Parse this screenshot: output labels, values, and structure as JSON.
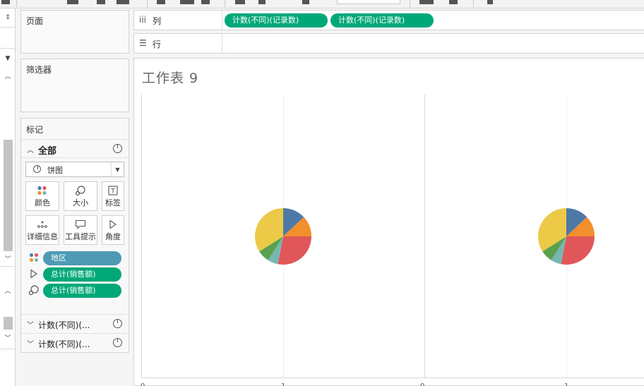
{
  "shelves": {
    "pages_label": "页面",
    "filters_label": "筛选器",
    "marks_label": "标记",
    "marks_all_label": "全部",
    "mark_type": "饼图",
    "mark_buttons": [
      {
        "label": "颜色",
        "icon": "color-dots-icon"
      },
      {
        "label": "大小",
        "icon": "size-icon"
      },
      {
        "label": "标签",
        "icon": "label-icon"
      },
      {
        "label": "详细信息",
        "icon": "detail-icon"
      },
      {
        "label": "工具提示",
        "icon": "tooltip-icon"
      },
      {
        "label": "角度",
        "icon": "angle-icon"
      }
    ],
    "mark_fields": [
      {
        "label": "地区",
        "icon": "color-dots-icon",
        "color": "#4e9ab4"
      },
      {
        "label": "总计(销售额)",
        "icon": "angle-icon",
        "color": "#00a878"
      },
      {
        "label": "总计(销售额)",
        "icon": "size-icon",
        "color": "#00a878"
      }
    ],
    "sub_cards": [
      "计数(不同)(...",
      "计数(不同)(..."
    ]
  },
  "columns": {
    "label": "列",
    "pills": [
      "计数(不同)(记录数)",
      "计数(不同)(记录数)"
    ]
  },
  "rows": {
    "label": "行"
  },
  "sheet": {
    "title": "工作表 9",
    "tick_labels": [
      "0",
      "1",
      "0",
      "1"
    ]
  },
  "colors": {
    "accent_green": "#00a878",
    "dimension_blue": "#4e9ab4"
  },
  "pies": [
    {
      "slices": [
        {
          "value": 13,
          "color": "#4e79a7"
        },
        {
          "value": 12,
          "color": "#f28e2b"
        },
        {
          "value": 28,
          "color": "#e15759"
        },
        {
          "value": 6,
          "color": "#76b7b2"
        },
        {
          "value": 7,
          "color": "#59a14f"
        },
        {
          "value": 34,
          "color": "#edc948"
        }
      ]
    },
    {
      "slices": [
        {
          "value": 13,
          "color": "#4e79a7"
        },
        {
          "value": 12,
          "color": "#f28e2b"
        },
        {
          "value": 28,
          "color": "#e15759"
        },
        {
          "value": 6,
          "color": "#76b7b2"
        },
        {
          "value": 7,
          "color": "#59a14f"
        },
        {
          "value": 34,
          "color": "#edc948"
        }
      ]
    }
  ]
}
